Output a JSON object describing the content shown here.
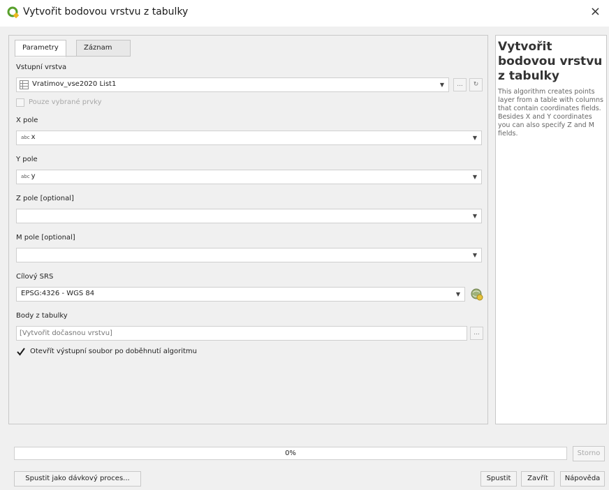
{
  "window": {
    "title": "Vytvořit bodovou vrstvu z tabulky",
    "close_label": "×"
  },
  "tabs": [
    {
      "label": "Parametry",
      "active": true
    },
    {
      "label": "Záznam",
      "active": false
    }
  ],
  "form": {
    "input_layer": {
      "label": "Vstupní vrstva",
      "value": "Vratimov_vse2020 List1",
      "btn_more": "...",
      "btn_iter": "↻",
      "selected_only": "Pouze vybrané prvky"
    },
    "x_field": {
      "label": "X pole",
      "type_tag": "abc",
      "value": "x"
    },
    "y_field": {
      "label": "Y pole",
      "type_tag": "abc",
      "value": "y"
    },
    "z_field": {
      "label": "Z pole [optional]",
      "value": ""
    },
    "m_field": {
      "label": "M pole [optional]",
      "value": ""
    },
    "target_crs": {
      "label": "Cílový SRS",
      "value": "EPSG:4326 - WGS 84"
    },
    "output": {
      "label": "Body z tabulky",
      "placeholder": "[Vytvořit dočasnou vrstvu]",
      "btn_more": "..."
    },
    "open_output": {
      "label": "Otevřít výstupní soubor po doběhnutí algoritmu",
      "checked": true
    }
  },
  "help": {
    "title": "Vytvořit bodovou vrstvu z tabulky",
    "body": "This algorithm creates points layer from a table with columns that contain coordinates fields. Besides X and Y coordinates you can also specify Z and M fields."
  },
  "progress": {
    "text": "0%",
    "value": 0
  },
  "buttons": {
    "cancel": "Storno",
    "batch": "Spustit jako dávkový proces...",
    "run": "Spustit",
    "close": "Zavřít",
    "help": "Nápověda"
  },
  "colors": {
    "accent_green": "#58a02c",
    "check": "#1a1a1a"
  }
}
